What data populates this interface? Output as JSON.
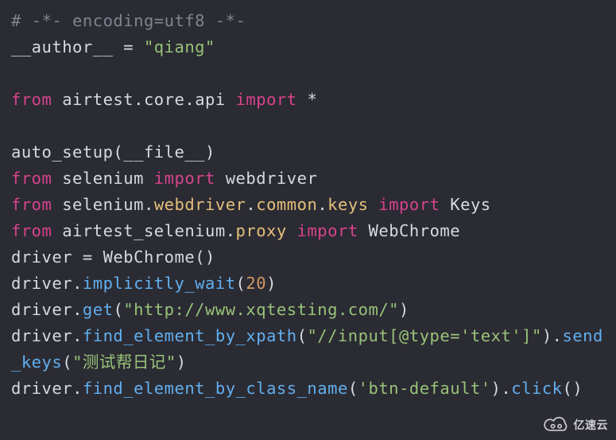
{
  "code": {
    "l1": {
      "comment": "# -*- encoding=utf8 -*-"
    },
    "l2": {
      "name": "__author__",
      "eq": " = ",
      "val": "\"qiang\""
    },
    "l3": {
      "blank": ""
    },
    "l4": {
      "from": "from ",
      "mod": "airtest",
      "dot1": ".",
      "sub1": "core",
      "dot2": ".",
      "sub2": "api",
      "imp": " import ",
      "star": "*"
    },
    "l5": {
      "blank": ""
    },
    "l6": {
      "fn": "auto_setup",
      "op": "(",
      "arg": "__file__",
      "cp": ")"
    },
    "l7": {
      "from": "from ",
      "mod": "selenium",
      "imp": " import ",
      "what": "webdriver"
    },
    "l8": {
      "from": "from ",
      "mod": "selenium",
      "dot1": ".",
      "sub1": "webdriver",
      "dot2": ".",
      "sub2": "common",
      "dot3": ".",
      "sub3": "keys",
      "imp": " import ",
      "what": "Keys"
    },
    "l9": {
      "from": "from ",
      "mod": "airtest_selenium",
      "dot1": ".",
      "sub1": "proxy",
      "imp": " import ",
      "what": "WebChrome"
    },
    "l10": {
      "lhs": "driver",
      "eq": " = ",
      "cls": "WebChrome",
      "op": "(",
      "cp": ")"
    },
    "l11": {
      "obj": "driver",
      "dot": ".",
      "fn": "implicitly_wait",
      "op": "(",
      "num": "20",
      "cp": ")"
    },
    "l12": {
      "obj": "driver",
      "dot": ".",
      "fn": "get",
      "op": "(",
      "str": "\"http://www.xqtesting.com/\"",
      "cp": ")"
    },
    "l13": {
      "obj": "driver",
      "dot": ".",
      "fn1": "find_element_by_xpath",
      "op1": "(",
      "str1": "\"//input[@type='text']\"",
      "cp1": ")",
      "dot2": ".",
      "fn2": "send_keys",
      "op2": "(",
      "str2": "\"测试帮日记\"",
      "cp2": ")"
    },
    "l14": {
      "obj": "driver",
      "dot": ".",
      "fn1": "find_element_by_class_name",
      "op1": "(",
      "str1": "'btn-default'",
      "cp1": ")",
      "dot2": ".",
      "fn2": "click",
      "op2": "(",
      "cp2": ")"
    }
  },
  "watermark": {
    "text": "亿速云"
  }
}
